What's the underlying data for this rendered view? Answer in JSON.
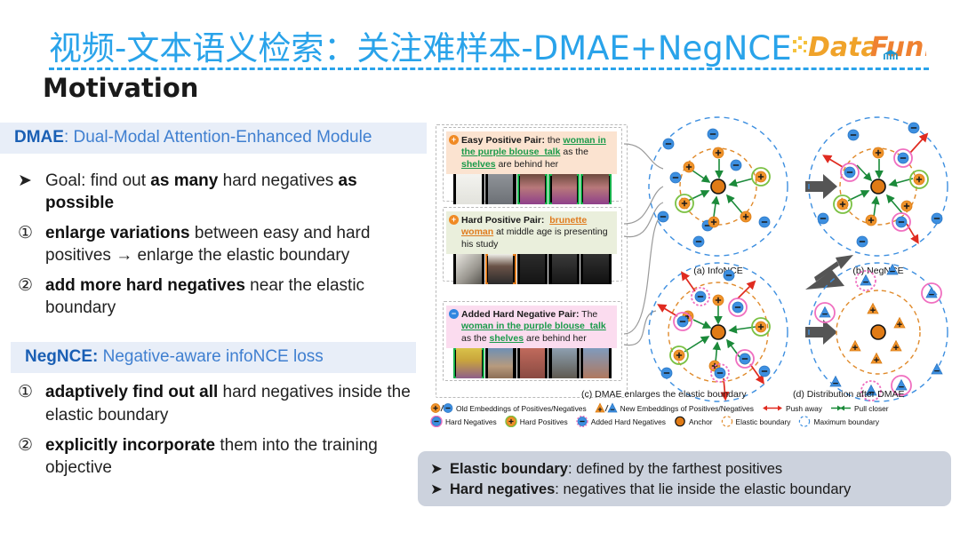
{
  "header": {
    "title": "视频-文本语义检索：关注难样本-DMAE+NegNCE",
    "brand": "DataFun.",
    "section": "Motivation",
    "accent": "#29a3ea"
  },
  "left": {
    "dmae_band": {
      "key": "DMAE",
      "rest": ": Dual-Modal Attention-Enhanced Module"
    },
    "dmae_items": [
      {
        "marker": "➤",
        "html": "Goal: find out  <b>as many</b> hard negatives <b>as possible</b>"
      },
      {
        "marker": "①",
        "html": "<b>enlarge variations</b> between easy and hard positives → enlarge the elastic boundary"
      },
      {
        "marker": "②",
        "html": "<b>add more hard negatives</b> near the elastic boundary"
      }
    ],
    "negnce_band": {
      "key": "NegNCE:",
      "rest": " Negative-aware infoNCE loss"
    },
    "negnce_items": [
      {
        "marker": "①",
        "html": "<b>adaptively find out all</b> hard negatives inside the elastic boundary"
      },
      {
        "marker": "②",
        "html": "<b>explicitly incorporate</b> them into the training objective"
      }
    ]
  },
  "figure": {
    "pairs": [
      {
        "badge": "+",
        "badge_color": "#f08a24",
        "bg": "#fbe3d0",
        "label": "Easy Positive Pair:",
        "html": "<span class=\"tag\">Easy Positive Pair:</span> the <span class=\"u-green\">woman in the purple blouse_talk</span> as the <span class=\"u-green\">shelves</span> are behind her",
        "selection": "green",
        "selected_frames": [
          2,
          3,
          4
        ]
      },
      {
        "badge": "+",
        "badge_color": "#f08a24",
        "bg": "#eaefdc",
        "label": "Hard Positive Pair:",
        "html": "<span class=\"tag\">Hard Positive Pair:</span>&nbsp; <span class=\"u-orange\">brunette woman</span> at middle age is presenting his study",
        "selection": "orange",
        "selected_frames": [
          1
        ]
      },
      {
        "badge": "−",
        "badge_color": "#2f86e0",
        "bg": "#fbdcef",
        "label": "Added Hard Negative Pair:",
        "html": "<span class=\"tag\">Added Hard Negative Pair:</span> The <span class=\"u-green\">woman in the purple blouse_talk</span> as the <span class=\"u-green\">shelves</span> are behind her",
        "selection": "green",
        "selected_frames": [
          0
        ]
      }
    ],
    "panels": [
      {
        "id": "a",
        "caption": "(a) InfoNCE"
      },
      {
        "id": "b",
        "caption": "(b) NegNCE"
      },
      {
        "id": "c",
        "caption": "(c) DMAE enlarges the elastic boundary"
      },
      {
        "id": "d",
        "caption": "(d) Distribution after DMAE"
      }
    ],
    "legend_row1": [
      {
        "icon": "old-embeddings",
        "label": "Old Embeddings of Positives/Negatives"
      },
      {
        "icon": "new-embeddings",
        "label": "New Embeddings of Positives/Negatives"
      },
      {
        "icon": "push-away-arrow",
        "label": "Push away"
      },
      {
        "icon": "pull-closer-arrow",
        "label": "Pull closer"
      }
    ],
    "legend_row2": [
      {
        "icon": "hard-negative",
        "label": "Hard Negatives"
      },
      {
        "icon": "hard-positive",
        "label": "Hard Positives"
      },
      {
        "icon": "added-hard-negative",
        "label": "Added Hard Negatives"
      },
      {
        "icon": "anchor",
        "label": "Anchor"
      },
      {
        "icon": "elastic-boundary",
        "label": "Elastic boundary"
      },
      {
        "icon": "maximum-boundary",
        "label": "Maximum boundary"
      }
    ]
  },
  "callout": {
    "items": [
      {
        "marker": "➤",
        "html": "<b>Elastic boundary</b>: defined by the farthest positives"
      },
      {
        "marker": "➤",
        "html": "<b>Hard negatives</b>: negatives that lie inside the elastic boundary"
      }
    ]
  }
}
